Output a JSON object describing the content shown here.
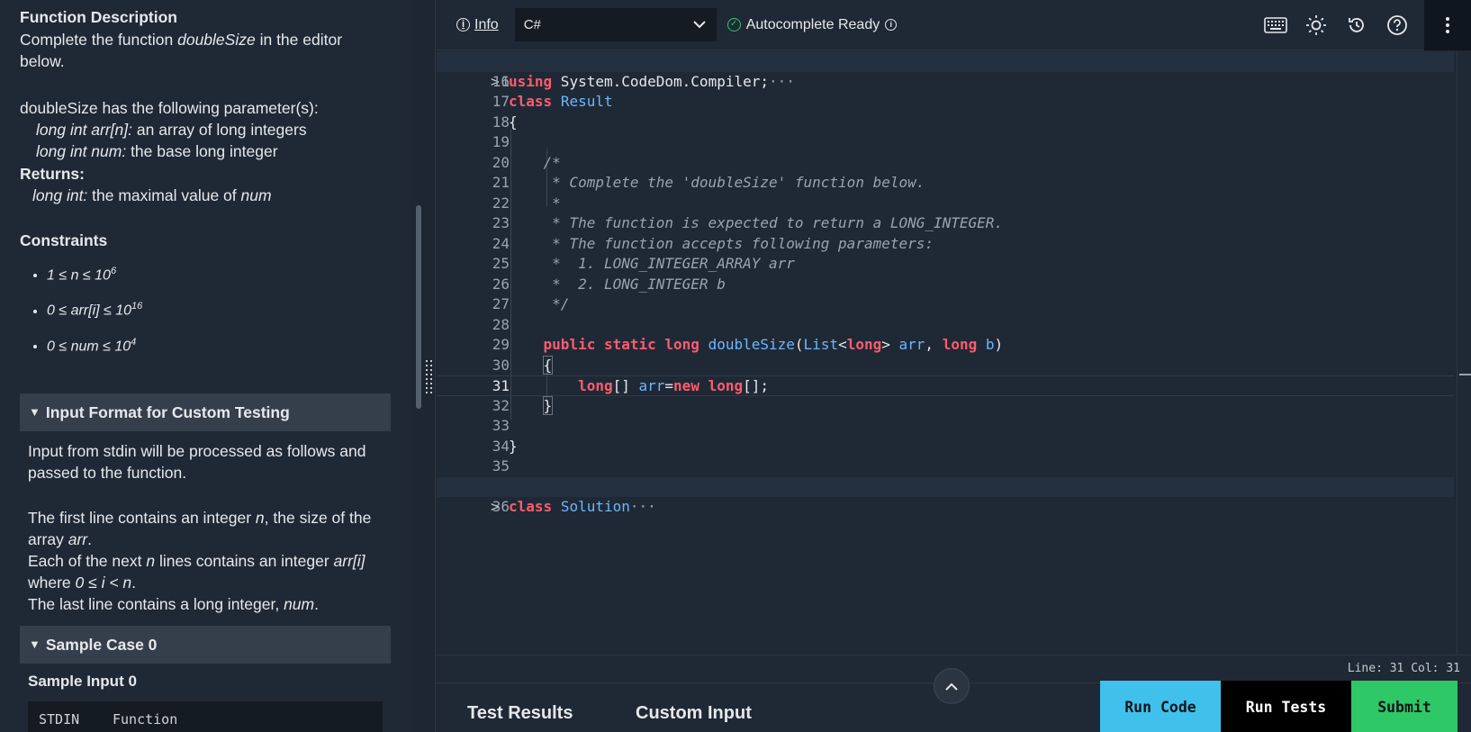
{
  "problem": {
    "func_desc_title": "Function Description",
    "func_desc_pre": "Complete the function ",
    "func_name": "doubleSize",
    "func_desc_post": " in the editor below.",
    "params_intro": "doubleSize has the following parameter(s):",
    "param1_type": "long int arr[n]:",
    "param1_desc": "  an array of long integers",
    "param2_type": "long int num:",
    "param2_desc": " the base long integer",
    "returns_title": "Returns:",
    "returns_type": "long int:",
    "returns_desc": " the maximal value of ",
    "returns_var": "num",
    "constraints_title": "Constraints",
    "constraints": [
      {
        "base": "1 ≤ n ≤ 10",
        "exp": "6"
      },
      {
        "base": "0 ≤ arr[i] ≤ 10",
        "exp": "16"
      },
      {
        "base": "0 ≤ num ≤ 10",
        "exp": "4"
      }
    ],
    "input_format_title": "Input Format for Custom Testing",
    "input_format_intro": "Input from stdin will be processed as follows and passed to the function.",
    "input_line1_a": "The first line contains an integer ",
    "input_line1_n": "n",
    "input_line1_b": ", the size of the array ",
    "input_line1_arr": "arr",
    "input_line1_c": ".",
    "input_line2_a": "Each of the next ",
    "input_line2_n": "n",
    "input_line2_b": " lines contains an integer ",
    "input_line2_arr": "arr[i]",
    "input_line2_c": " where ",
    "input_line2_cond": "0 ≤ i < n",
    "input_line2_d": ".",
    "input_line3_a": "The last line contains a long integer, ",
    "input_line3_num": "num",
    "input_line3_b": ".",
    "sample_title": "Sample Case 0",
    "sample_input_title": "Sample Input 0",
    "stdin_col": "STDIN",
    "function_col": "Function"
  },
  "toolbar": {
    "info_label": "Info",
    "language": "C#",
    "autocomplete_label": "Autocomplete Ready"
  },
  "editor": {
    "status": "Line: 31 Col: 31"
  },
  "bottom": {
    "test_results_tab": "Test Results",
    "custom_input_tab": "Custom Input",
    "run_code_label": "Run Code",
    "run_tests_label": "Run Tests",
    "submit_label": "Submit"
  },
  "colors": {
    "keyword": "#ff5b6e",
    "type": "#6cb6ff",
    "run_code": "#40c1eb",
    "run_tests": "#000000",
    "submit": "#2ec866"
  }
}
